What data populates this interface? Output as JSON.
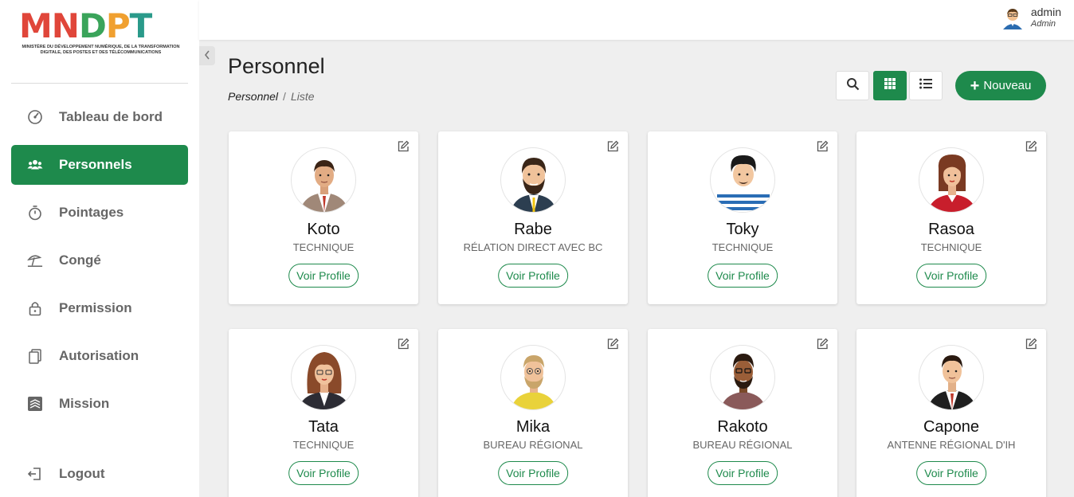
{
  "brand": {
    "logo_text": "MNDPT",
    "logo_subtitle": "MINISTÈRE DU DÉVELOPPEMENT NUMÉRIQUE, DE LA TRANSFORMATION DIGITALE, DES POSTES ET DES TÉLÉCOMMUNICATIONS",
    "colors": {
      "red": "#e0463a",
      "green": "#3aa45a",
      "orange": "#f0a030",
      "teal": "#2a9a8a",
      "primary": "#1e8a4c"
    }
  },
  "sidebar": {
    "items": [
      {
        "label": "Tableau de bord",
        "icon": "dashboard-icon",
        "active": false
      },
      {
        "label": "Personnels",
        "icon": "users-icon",
        "active": true
      },
      {
        "label": "Pointages",
        "icon": "stopwatch-icon",
        "active": false
      },
      {
        "label": "Congé",
        "icon": "beach-umbrella-icon",
        "active": false
      },
      {
        "label": "Permission",
        "icon": "lock-icon",
        "active": false
      },
      {
        "label": "Autorisation",
        "icon": "documents-icon",
        "active": false
      },
      {
        "label": "Mission",
        "icon": "stack-icon",
        "active": false
      }
    ],
    "logout_label": "Logout"
  },
  "topbar": {
    "user_name": "admin",
    "user_role": "Admin"
  },
  "header": {
    "title": "Personnel",
    "breadcrumb": {
      "parent": "Personnel",
      "separator": "/",
      "current": "Liste"
    },
    "new_button_label": "Nouveau"
  },
  "cards": [
    {
      "name": "Koto",
      "role": "TECHNIQUE",
      "button": "Voir Profile",
      "avatar": "man-suit-avatar"
    },
    {
      "name": "Rabe",
      "role": "RÉLATION DIRECT AVEC BC",
      "button": "Voir Profile",
      "avatar": "man-beard-avatar"
    },
    {
      "name": "Toky",
      "role": "TECHNIQUE",
      "button": "Voir Profile",
      "avatar": "man-striped-shirt-avatar"
    },
    {
      "name": "Rasoa",
      "role": "TECHNIQUE",
      "button": "Voir Profile",
      "avatar": "woman-red-avatar"
    },
    {
      "name": "Tata",
      "role": "TECHNIQUE",
      "button": "Voir Profile",
      "avatar": "woman-glasses-avatar"
    },
    {
      "name": "Mika",
      "role": "BUREAU RÉGIONAL",
      "button": "Voir Profile",
      "avatar": "man-yellow-avatar"
    },
    {
      "name": "Rakoto",
      "role": "BUREAU RÉGIONAL",
      "button": "Voir Profile",
      "avatar": "man-glasses-avatar"
    },
    {
      "name": "Capone",
      "role": "ANTENNE RÉGIONAL D'IH",
      "button": "Voir Profile",
      "avatar": "man-tie-avatar"
    }
  ]
}
